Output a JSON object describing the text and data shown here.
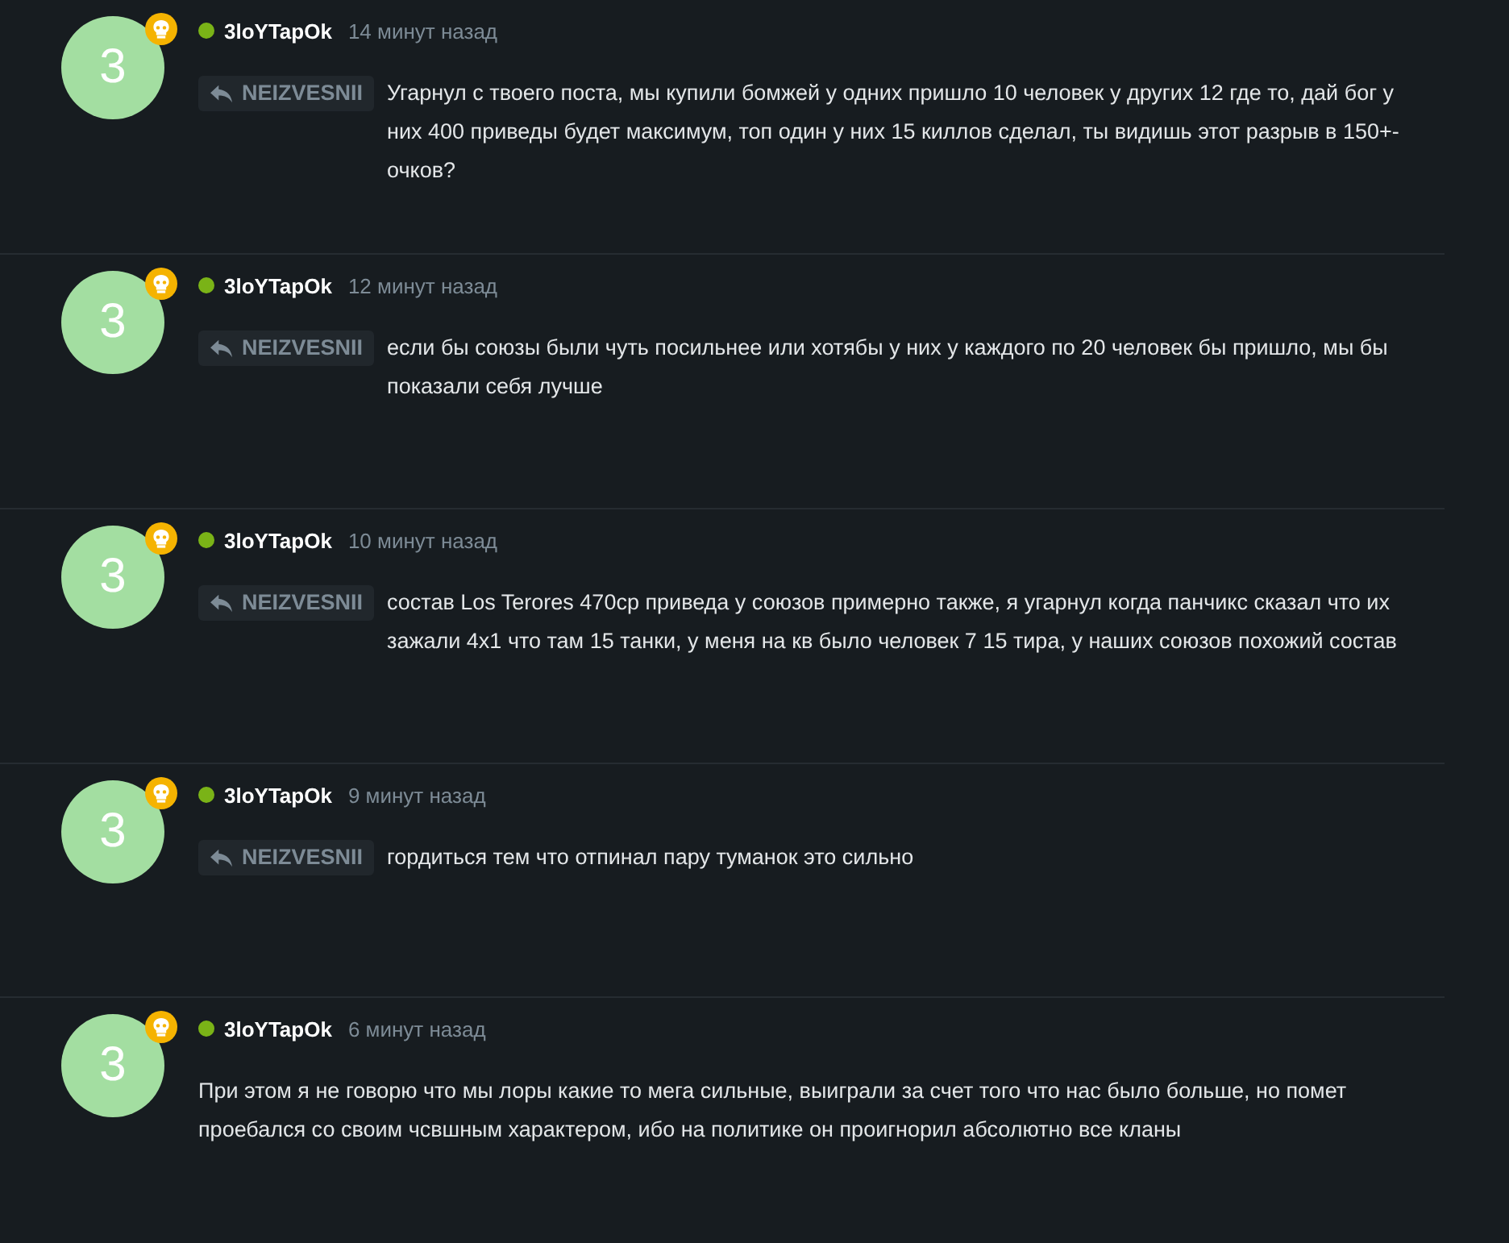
{
  "comments": [
    {
      "avatar": "3",
      "author": "3loYTapOk",
      "online": true,
      "time": "14 минут назад",
      "reply_to": "NEIZVESNII",
      "text": "Угарнул с твоего поста, мы купили бомжей у одних пришло 10 человек у других 12 где то, дай бог у них 400 приведы будет максимум, топ один у них 15 киллов сделал, ты видишь этот разрыв в 150+- очков?"
    },
    {
      "avatar": "3",
      "author": "3loYTapOk",
      "online": true,
      "time": "12 минут назад",
      "reply_to": "NEIZVESNII",
      "text": "если бы союзы были чуть посильнее или хотябы у них у каждого по 20 человек бы пришло, мы бы показали себя лучше"
    },
    {
      "avatar": "3",
      "author": "3loYTapOk",
      "online": true,
      "time": "10 минут назад",
      "reply_to": "NEIZVESNII",
      "text": "состав Los Terores 470ср приведа у союзов примерно также, я угарнул когда панчикс сказал что их зажали 4х1 что там 15 танки, у меня на кв было человек 7 15 тира, у наших союзов похожий состав"
    },
    {
      "avatar": "3",
      "author": "3loYTapOk",
      "online": true,
      "time": "9 минут назад",
      "reply_to": "NEIZVESNII",
      "text": "гордиться тем что отпинал пару туманок это сильно"
    },
    {
      "avatar": "3",
      "author": "3loYTapOk",
      "online": true,
      "time": "6 минут назад",
      "text": "При этом я не говорю что мы лоры какие то мега сильные, выиграли за счет того что нас было больше, но помет проебался со своим чсвшным характером, ибо на политике он проигнорил абсолютно все кланы"
    }
  ]
}
